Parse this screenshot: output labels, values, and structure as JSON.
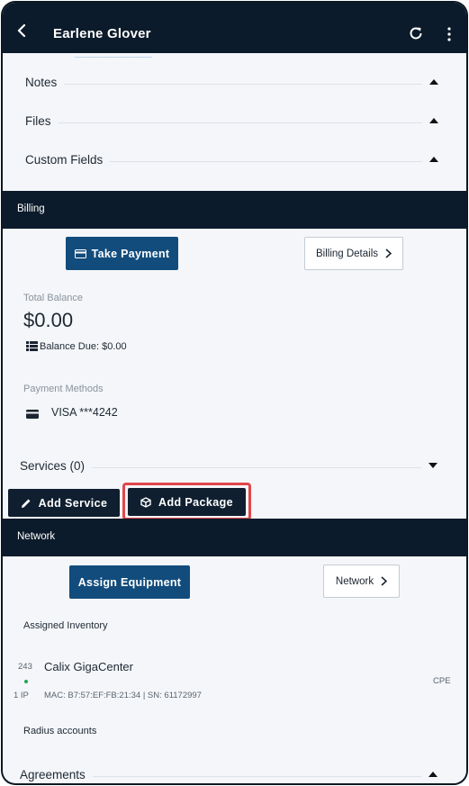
{
  "header": {
    "title": "Earlene Glover",
    "back_icon": "chevron-left-icon",
    "refresh_icon": "refresh-icon",
    "more_icon": "more-vertical-icon"
  },
  "sections": {
    "notes": "Notes",
    "files": "Files",
    "custom_fields": "Custom Fields",
    "services": "Services (0)",
    "agreements": "Agreements"
  },
  "billing": {
    "band_label": "Billing",
    "take_payment": "Take Payment",
    "billing_details": "Billing Details",
    "total_balance_label": "Total Balance",
    "total_balance": "$0.00",
    "balance_due": "Balance Due: $0.00",
    "payment_methods_label": "Payment Methods",
    "payment_method": "VISA ***4242"
  },
  "services_actions": {
    "add_service": "Add Service",
    "add_package": "Add Package"
  },
  "network": {
    "band_label": "Network",
    "assign_equipment": "Assign Equipment",
    "network_button": "Network",
    "assigned_inventory_label": "Assigned Inventory",
    "device_count": "243",
    "device_name": "Calix GigaCenter",
    "ip_count": "1 IP",
    "mac_sn": "MAC: B7:57:EF:FB:21:34  |  SN: 61172997",
    "device_type": "CPE",
    "radius_label": "Radius accounts"
  },
  "colors": {
    "header_bg": "#0c1b2b",
    "primary": "#124c7c",
    "highlight": "#e1474a",
    "status_online": "#1fa65a"
  }
}
